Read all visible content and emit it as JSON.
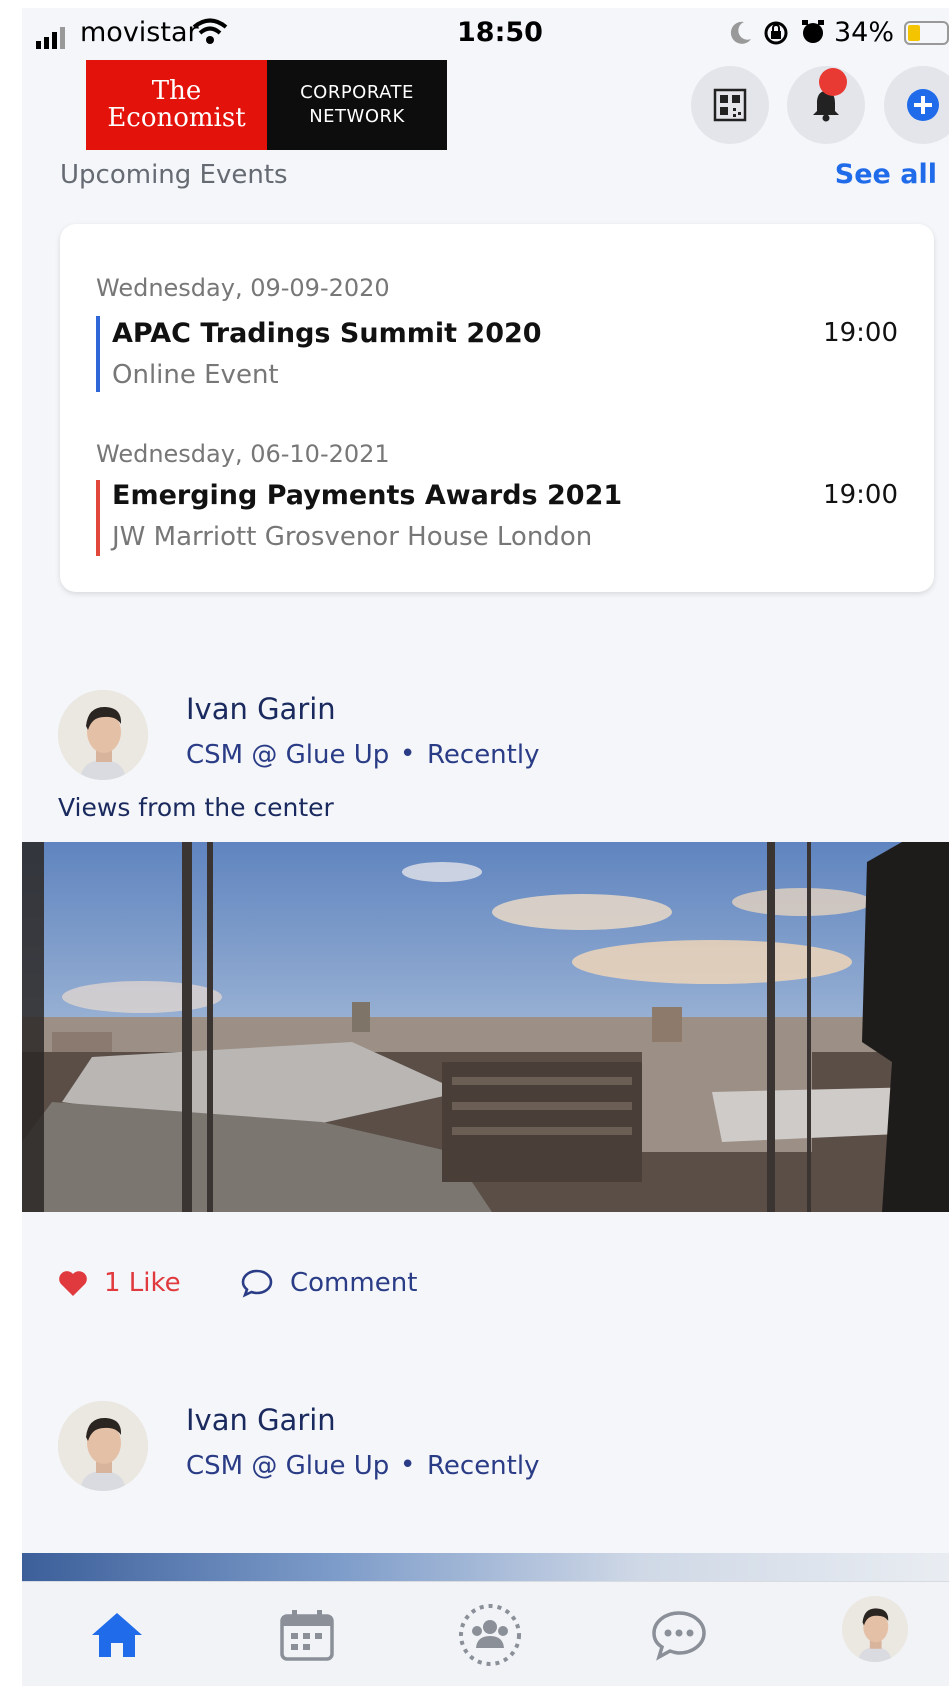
{
  "status_bar": {
    "carrier": "movistar",
    "time": "18:50",
    "battery": "34%"
  },
  "header": {
    "logo_line1": "The",
    "logo_line2": "Economist",
    "logo_right1": "CORPORATE",
    "logo_right2": "NETWORK"
  },
  "upcoming": {
    "title": "Upcoming Events",
    "see_all": "See all",
    "events": [
      {
        "date": "Wednesday, 09-09-2020",
        "title": "APAC Tradings Summit 2020",
        "location": "Online Event",
        "time": "19:00",
        "color": "#2f66d8"
      },
      {
        "date": "Wednesday, 06-10-2021",
        "title": "Emerging Payments Awards 2021",
        "location": "JW Marriott Grosvenor House London",
        "time": "19:00",
        "color": "#e2473c"
      }
    ]
  },
  "posts": [
    {
      "author": "Ivan Garin",
      "role": "CSM @ Glue Up",
      "time": "Recently",
      "text": "Views from the center",
      "likes": "1 Like",
      "comment": "Comment"
    },
    {
      "author": "Ivan Garin",
      "role": "CSM @ Glue Up",
      "time": "Recently"
    }
  ],
  "colors": {
    "accent": "#1f6bea",
    "like": "#e03a3e",
    "navy": "#1a2a5e",
    "brand_red": "#e3120b"
  },
  "tabs": [
    "home-icon",
    "calendar-icon",
    "community-icon",
    "chat-icon",
    "profile-avatar"
  ]
}
